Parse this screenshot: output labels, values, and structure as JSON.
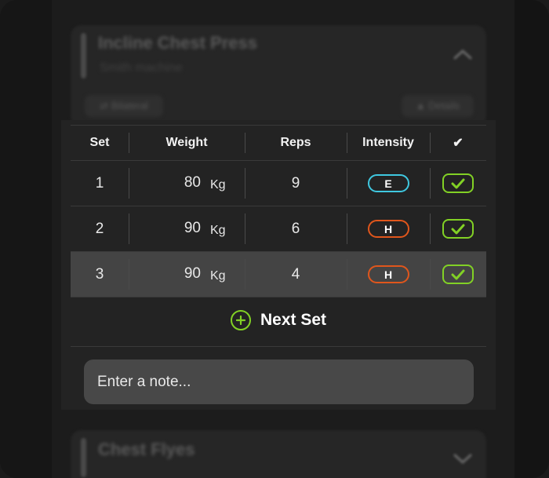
{
  "background": {
    "exercise_title": "Incline Chest Press",
    "exercise_subtitle": "Smith machine",
    "bilateral_label": "Bilateral",
    "details_label": "Details",
    "next_exercise_title": "Chest Flyes"
  },
  "table": {
    "headers": {
      "set": "Set",
      "weight": "Weight",
      "reps": "Reps",
      "intensity": "Intensity",
      "done": "✔"
    },
    "rows": [
      {
        "set": "1",
        "weight": "80",
        "unit": "Kg",
        "reps": "9",
        "intensity": "E",
        "done": true
      },
      {
        "set": "2",
        "weight": "90",
        "unit": "Kg",
        "reps": "6",
        "intensity": "H",
        "done": true
      },
      {
        "set": "3",
        "weight": "90",
        "unit": "Kg",
        "reps": "4",
        "intensity": "H",
        "done": true
      }
    ]
  },
  "next_set_label": "Next Set",
  "note_placeholder": "Enter a note...",
  "colors": {
    "accent_green": "#82d125",
    "intensity_easy": "#3fc8e0",
    "intensity_hard": "#e0561c",
    "highlight_row": "#444444"
  },
  "icons": {
    "next_set": "plus-circle-icon",
    "done": "checkmark-icon",
    "collapse": "chevron-up-icon"
  }
}
